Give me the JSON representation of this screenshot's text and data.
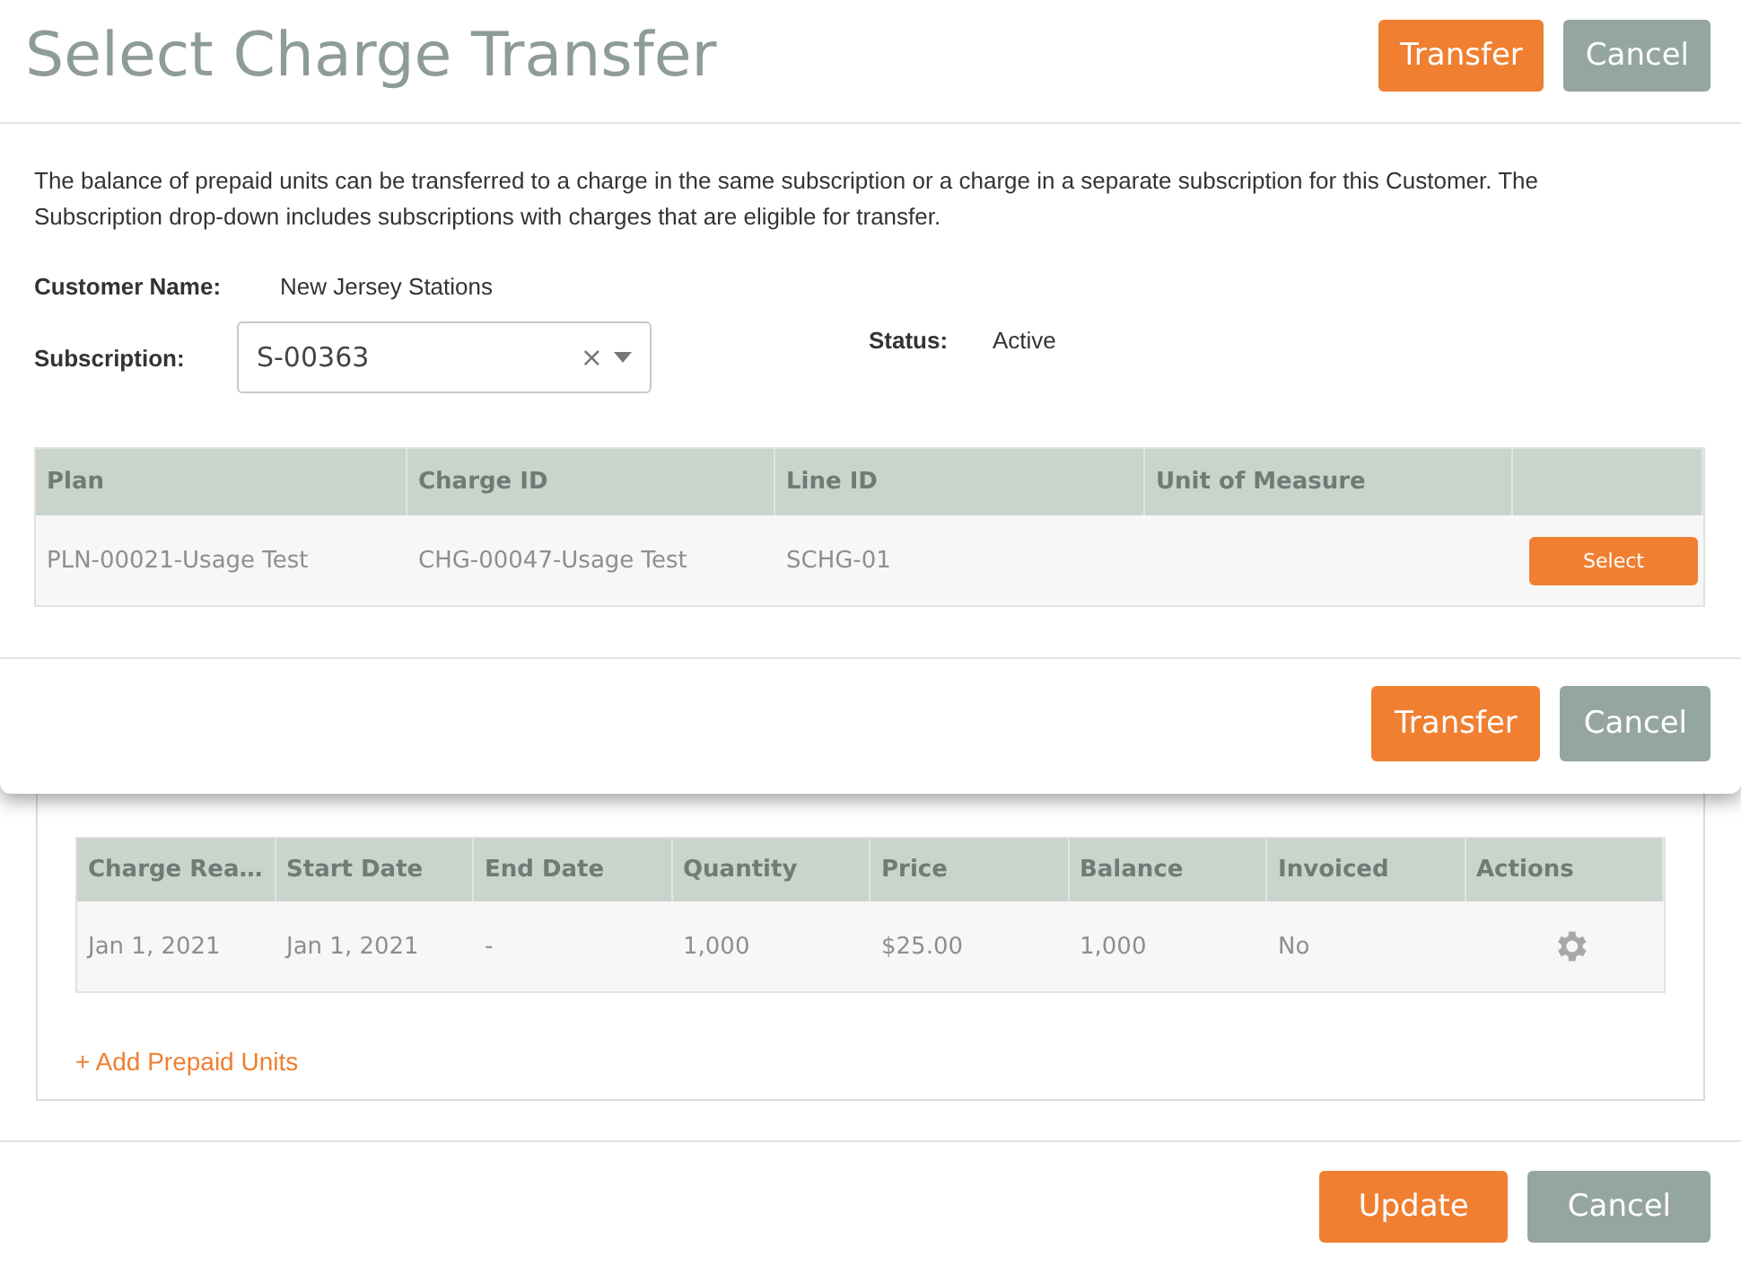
{
  "modal": {
    "title": "Select Charge Transfer",
    "header_buttons": [
      {
        "label": "Transfer",
        "kind": "primary"
      },
      {
        "label": "Cancel",
        "kind": "secondary"
      }
    ],
    "description": "The balance of prepaid units can be transferred to a charge in the same subscription or a charge in a separate subscription for this Customer. The Subscription drop-down includes subscriptions with charges that are eligible for transfer.",
    "customer_name": {
      "label": "Customer Name:",
      "value": "New Jersey Stations"
    },
    "subscription": {
      "label": "Subscription:",
      "value": "S-00363",
      "clear": "×"
    },
    "status": {
      "label": "Status:",
      "value": "Active"
    },
    "table": {
      "columns": [
        "Plan",
        "Charge ID",
        "Line ID",
        "Unit of Measure"
      ],
      "rows": [
        {
          "cells": [
            "PLN-00021-Usage Test",
            "CHG-00047-Usage Test",
            "SCHG-01",
            ""
          ],
          "action": "Select"
        }
      ]
    },
    "footer_buttons": [
      {
        "label": "Transfer",
        "kind": "primary"
      },
      {
        "label": "Cancel",
        "kind": "secondary"
      }
    ]
  },
  "background": {
    "table": {
      "columns": [
        "Charge Rea…",
        "Start Date",
        "End Date",
        "Quantity",
        "Price",
        "Balance",
        "Invoiced",
        "Actions"
      ],
      "rows": [
        {
          "cells": [
            "Jan 1, 2021",
            "Jan 1, 2021",
            "-",
            "1,000",
            "$25.00",
            "1,000",
            "No"
          ]
        }
      ]
    },
    "add_link": "+ Add Prepaid Units",
    "footer_buttons": [
      {
        "label": "Update",
        "kind": "primary"
      },
      {
        "label": "Cancel",
        "kind": "secondary"
      }
    ]
  }
}
